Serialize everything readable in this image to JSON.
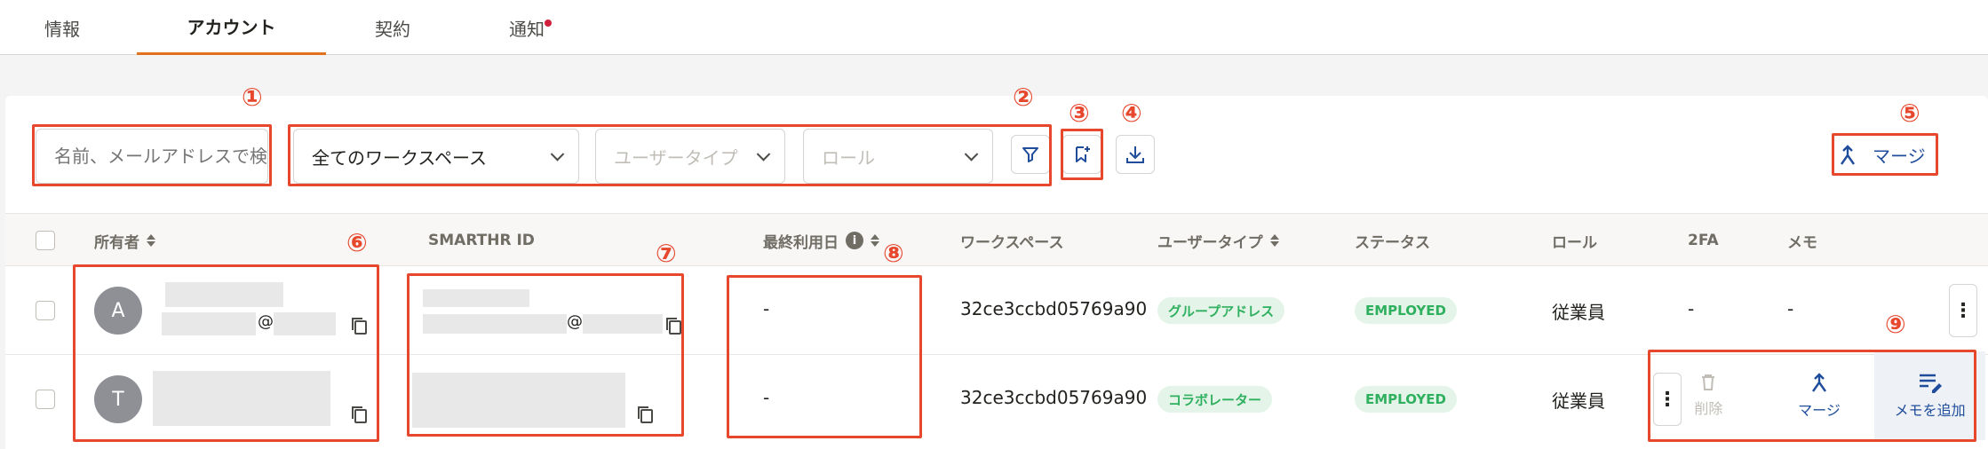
{
  "tabs": [
    {
      "label": "情報"
    },
    {
      "label": "アカウント"
    },
    {
      "label": "契約"
    },
    {
      "label": "通知"
    }
  ],
  "filters": {
    "search_placeholder": "名前、メールアドレスで検索",
    "workspace": "全てのワークスペース",
    "user_type_placeholder": "ユーザータイプ",
    "role_placeholder": "ロール"
  },
  "toolbar": {
    "merge_label": "マージ"
  },
  "annotations": [
    "①",
    "②",
    "③",
    "④",
    "⑤",
    "⑥",
    "⑦",
    "⑧",
    "⑨"
  ],
  "table": {
    "headers": {
      "owner": "所有者",
      "smarthr_id": "SMARTHR ID",
      "last_used": "最終利用日",
      "workspace": "ワークスペース",
      "user_type": "ユーザータイプ",
      "status": "ステータス",
      "role": "ロール",
      "twofa": "2FA",
      "memo": "メモ"
    },
    "rows": [
      {
        "avatar": "A",
        "email_at": "@",
        "id_at": "@",
        "last_used": "-",
        "workspace": "32ce3ccbd05769a90",
        "user_type": "グループアドレス",
        "status": "EMPLOYED",
        "role": "従業員",
        "twofa": "-",
        "memo": "-"
      },
      {
        "avatar": "T",
        "last_used": "-",
        "workspace": "32ce3ccbd05769a90",
        "user_type": "コラボレーター",
        "status": "EMPLOYED",
        "role": "従業員"
      }
    ]
  },
  "row_actions": {
    "delete_label": "削除",
    "merge_label": "マージ",
    "add_memo_label": "メモを追加"
  },
  "colors": {
    "accent": "#e2711d",
    "annotation": "#e7472d",
    "link": "#1f4d9c",
    "status_green": "#2fb05f"
  }
}
